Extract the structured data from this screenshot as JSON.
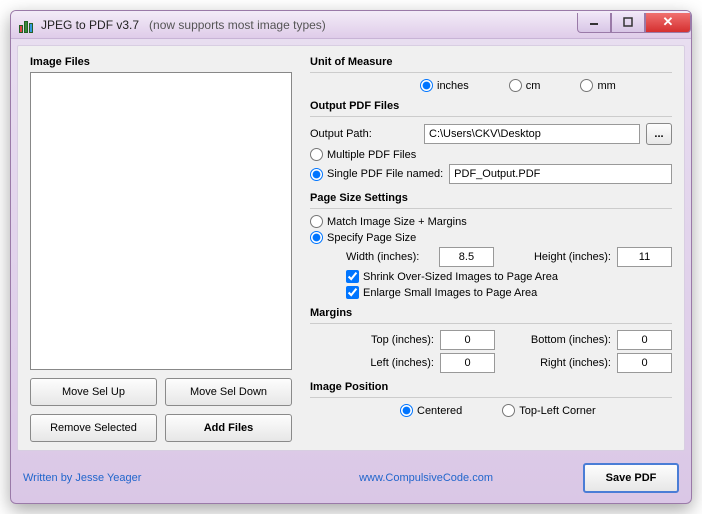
{
  "window": {
    "title": "JPEG to PDF  v3.7",
    "subtitle": "(now supports most image types)"
  },
  "left_panel": {
    "heading": "Image Files",
    "move_up": "Move Sel Up",
    "move_down": "Move Sel Down",
    "remove": "Remove Selected",
    "add": "Add Files"
  },
  "unit": {
    "heading": "Unit of Measure",
    "inches": "inches",
    "cm": "cm",
    "mm": "mm"
  },
  "output": {
    "heading": "Output PDF Files",
    "path_label": "Output Path:",
    "path_value": "C:\\Users\\CKV\\Desktop",
    "browse": "...",
    "multiple": "Multiple PDF Files",
    "single": "Single PDF File named:",
    "single_value": "PDF_Output.PDF"
  },
  "page": {
    "heading": "Page Size Settings",
    "match": "Match Image Size + Margins",
    "specify": "Specify Page Size",
    "width_label": "Width (inches):",
    "width_value": "8.5",
    "height_label": "Height (inches):",
    "height_value": "11",
    "shrink": "Shrink Over-Sized Images to Page Area",
    "enlarge": "Enlarge Small Images to Page Area"
  },
  "margins": {
    "heading": "Margins",
    "top_label": "Top (inches):",
    "top_value": "0",
    "bottom_label": "Bottom (inches):",
    "bottom_value": "0",
    "left_label": "Left (inches):",
    "left_value": "0",
    "right_label": "Right (inches):",
    "right_value": "0"
  },
  "position": {
    "heading": "Image Position",
    "centered": "Centered",
    "topleft": "Top-Left Corner"
  },
  "footer": {
    "author": "Written by Jesse Yeager",
    "site": "www.CompulsiveCode.com",
    "save": "Save PDF"
  }
}
